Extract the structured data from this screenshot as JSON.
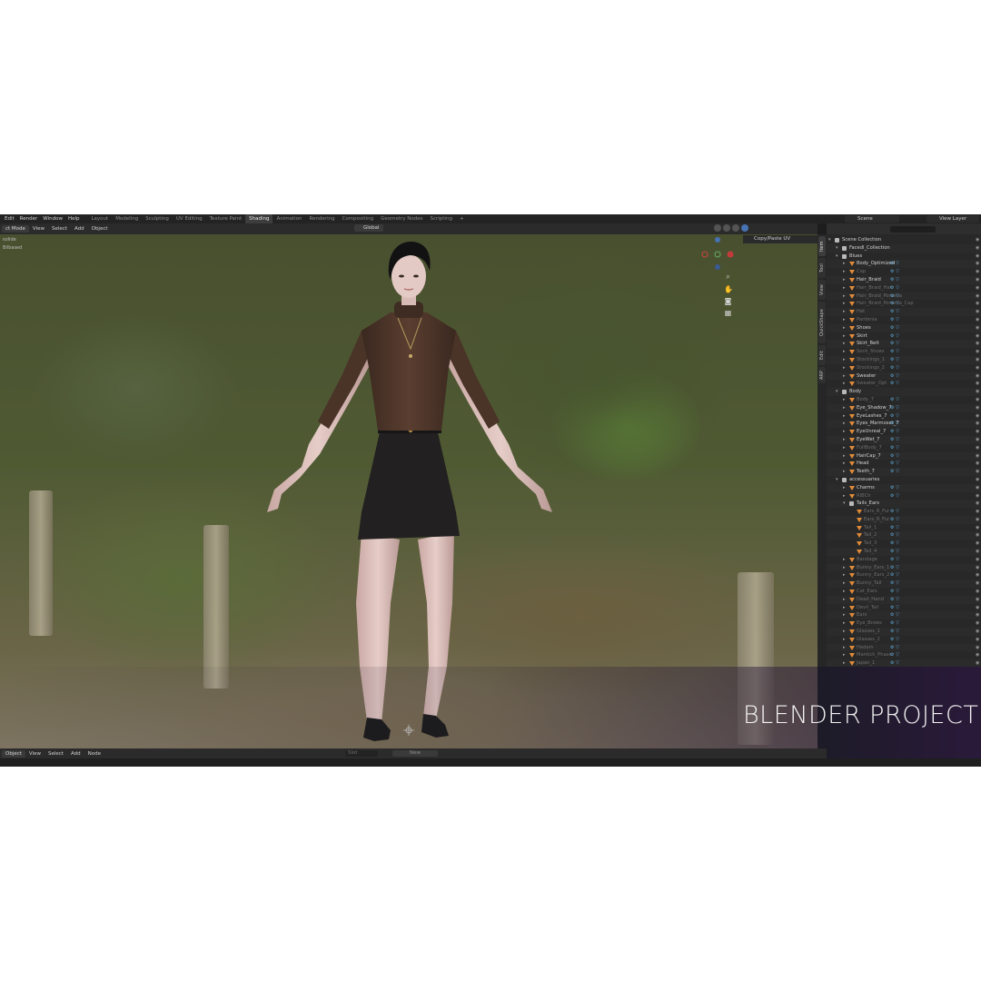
{
  "menu": [
    "Edit",
    "Render",
    "Window",
    "Help"
  ],
  "workspaces": [
    {
      "label": "Layout",
      "active": false
    },
    {
      "label": "Modeling",
      "active": false
    },
    {
      "label": "Sculpting",
      "active": false
    },
    {
      "label": "UV Editing",
      "active": false
    },
    {
      "label": "Texture Paint",
      "active": false
    },
    {
      "label": "Shading",
      "active": true
    },
    {
      "label": "Animation",
      "active": false
    },
    {
      "label": "Rendering",
      "active": false
    },
    {
      "label": "Compositing",
      "active": false
    },
    {
      "label": "Geometry Nodes",
      "active": false
    },
    {
      "label": "Scripting",
      "active": false
    }
  ],
  "workspace_add": "+",
  "scene": {
    "label": "Scene"
  },
  "view_layer": {
    "label": "View Layer"
  },
  "viewport_header": {
    "mode": "ct Mode",
    "items": [
      "View",
      "Select",
      "Add",
      "Object"
    ],
    "orientation": "Global"
  },
  "viewport_overlay_left": [
    "solide",
    "Bilbased"
  ],
  "copy_paste_uv": "Copy/Paste UV",
  "sidebar_tabs": [
    "Item",
    "Tool",
    "View",
    "QuickShape",
    "Edit",
    "ARP"
  ],
  "outliner": {
    "rows": [
      {
        "name": "Scene Collection",
        "depth": 0,
        "type": "coll",
        "dim": false
      },
      {
        "name": "Facedl_Collection",
        "depth": 1,
        "type": "coll",
        "dim": false
      },
      {
        "name": "Blues",
        "depth": 1,
        "type": "coll",
        "dim": false
      },
      {
        "name": "Body_Optimized",
        "depth": 2,
        "type": "obj",
        "dim": false
      },
      {
        "name": "Cap",
        "depth": 2,
        "type": "obj",
        "dim": true
      },
      {
        "name": "Hair_Braid",
        "depth": 2,
        "type": "obj",
        "dim": false
      },
      {
        "name": "Hair_Braid_Hat",
        "depth": 2,
        "type": "obj",
        "dim": true
      },
      {
        "name": "Hair_Braid_Ponania",
        "depth": 2,
        "type": "obj",
        "dim": true
      },
      {
        "name": "Hair_Braid_Ponania_Cap",
        "depth": 2,
        "type": "obj",
        "dim": true
      },
      {
        "name": "Hat",
        "depth": 2,
        "type": "obj",
        "dim": true
      },
      {
        "name": "Pantenia",
        "depth": 2,
        "type": "obj",
        "dim": true
      },
      {
        "name": "Shoes",
        "depth": 2,
        "type": "obj",
        "dim": false
      },
      {
        "name": "Skirt",
        "depth": 2,
        "type": "obj",
        "dim": false
      },
      {
        "name": "Skirt_Belt",
        "depth": 2,
        "type": "obj",
        "dim": false
      },
      {
        "name": "Sock_Shoes",
        "depth": 2,
        "type": "obj",
        "dim": true
      },
      {
        "name": "Stockings_1",
        "depth": 2,
        "type": "obj",
        "dim": true
      },
      {
        "name": "Stockings_2",
        "depth": 2,
        "type": "obj",
        "dim": true
      },
      {
        "name": "Sweater",
        "depth": 2,
        "type": "obj",
        "dim": false
      },
      {
        "name": "Sweater_Opt",
        "depth": 2,
        "type": "obj",
        "dim": true
      },
      {
        "name": "Body",
        "depth": 1,
        "type": "coll",
        "dim": false
      },
      {
        "name": "Body_7",
        "depth": 2,
        "type": "obj",
        "dim": true
      },
      {
        "name": "Eye_Shadow_7",
        "depth": 2,
        "type": "obj",
        "dim": false
      },
      {
        "name": "EyeLashes_7",
        "depth": 2,
        "type": "obj",
        "dim": false
      },
      {
        "name": "Eyes_Marmoset_7",
        "depth": 2,
        "type": "obj",
        "dim": false
      },
      {
        "name": "EyeUnreal_7",
        "depth": 2,
        "type": "obj",
        "dim": false
      },
      {
        "name": "EyeWet_7",
        "depth": 2,
        "type": "obj",
        "dim": false
      },
      {
        "name": "FullBody_7",
        "depth": 2,
        "type": "obj",
        "dim": true
      },
      {
        "name": "HairCap_7",
        "depth": 2,
        "type": "obj",
        "dim": false
      },
      {
        "name": "Head",
        "depth": 2,
        "type": "obj",
        "dim": false
      },
      {
        "name": "Teeth_7",
        "depth": 2,
        "type": "obj",
        "dim": false
      },
      {
        "name": "accessuaries",
        "depth": 1,
        "type": "coll",
        "dim": false
      },
      {
        "name": "Charms",
        "depth": 2,
        "type": "obj",
        "dim": false
      },
      {
        "name": "RIBCh",
        "depth": 2,
        "type": "obj",
        "dim": true
      },
      {
        "name": "Tails_Ears",
        "depth": 2,
        "type": "coll",
        "dim": false
      },
      {
        "name": "Ears_R_Fur",
        "depth": 3,
        "type": "obj",
        "dim": true
      },
      {
        "name": "Ears_R_Fur",
        "depth": 3,
        "type": "obj",
        "dim": true
      },
      {
        "name": "Tail_1",
        "depth": 3,
        "type": "obj",
        "dim": true
      },
      {
        "name": "Tail_2",
        "depth": 3,
        "type": "obj",
        "dim": true
      },
      {
        "name": "Tail_3",
        "depth": 3,
        "type": "obj",
        "dim": true
      },
      {
        "name": "Tail_4",
        "depth": 3,
        "type": "obj",
        "dim": true
      },
      {
        "name": "Bandage",
        "depth": 2,
        "type": "obj",
        "dim": true
      },
      {
        "name": "Bunny_Ears_1",
        "depth": 2,
        "type": "obj",
        "dim": true
      },
      {
        "name": "Bunny_Ears_2",
        "depth": 2,
        "type": "obj",
        "dim": true
      },
      {
        "name": "Bunny_Tail",
        "depth": 2,
        "type": "obj",
        "dim": true
      },
      {
        "name": "Cat_Ears",
        "depth": 2,
        "type": "obj",
        "dim": true
      },
      {
        "name": "Dead_Hand",
        "depth": 2,
        "type": "obj",
        "dim": true
      },
      {
        "name": "Devil_Tail",
        "depth": 2,
        "type": "obj",
        "dim": true
      },
      {
        "name": "Ears",
        "depth": 2,
        "type": "obj",
        "dim": true
      },
      {
        "name": "Eye_Brows",
        "depth": 2,
        "type": "obj",
        "dim": true
      },
      {
        "name": "Glasses_1",
        "depth": 2,
        "type": "obj",
        "dim": true
      },
      {
        "name": "Glasses_2",
        "depth": 2,
        "type": "obj",
        "dim": true
      },
      {
        "name": "Hadam",
        "depth": 2,
        "type": "obj",
        "dim": true
      },
      {
        "name": "Mantich_Phase",
        "depth": 2,
        "type": "obj",
        "dim": true
      },
      {
        "name": "Japan_1",
        "depth": 2,
        "type": "obj",
        "dim": true
      }
    ]
  },
  "bottom_bar": {
    "mode": "Object",
    "items": [
      "View",
      "Select",
      "Add",
      "Node"
    ],
    "slot": "Slot",
    "new": "New"
  },
  "title_overlay": "BLENDER PROJECT",
  "icons": {
    "search": "search-icon",
    "hand": "hand-icon",
    "camera": "camera-icon",
    "grid": "grid-icon",
    "eye": "eye-icon"
  },
  "colors": {
    "accent": "#4772b3",
    "object_icon": "#e08b3a",
    "overlay": "#2a1a3a"
  }
}
